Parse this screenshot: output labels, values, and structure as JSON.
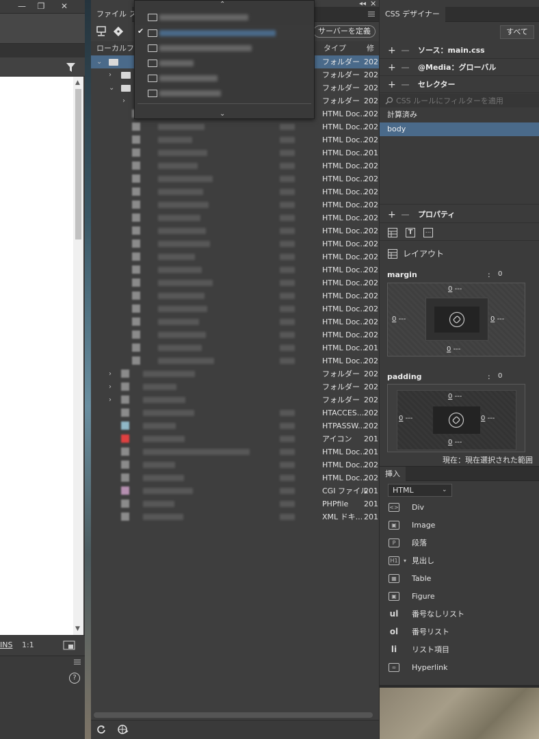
{
  "left_window": {
    "minimize": "—",
    "restore": "❐",
    "close": "✕",
    "status_ins": "INS",
    "status_zoom": "1:1",
    "help": "?"
  },
  "files_panel": {
    "tabs": {
      "file": "ファイル",
      "second": "ス"
    },
    "define_server": "サーバーを定義",
    "header_local": "ローカルファ",
    "header_type": "タイプ",
    "header_mod": "修",
    "rows": [
      {
        "type": "フォルダー",
        "mod": "202"
      },
      {
        "type": "フォルダー",
        "mod": "202"
      },
      {
        "type": "フォルダー",
        "mod": "202"
      },
      {
        "type": "フォルダー",
        "mod": "202"
      },
      {
        "type": "HTML Doc...",
        "mod": "202"
      },
      {
        "type": "HTML Doc...",
        "mod": "202"
      },
      {
        "type": "HTML Doc...",
        "mod": "202"
      },
      {
        "type": "HTML Doc...",
        "mod": "201"
      },
      {
        "type": "HTML Doc...",
        "mod": "202"
      },
      {
        "type": "HTML Doc...",
        "mod": "202"
      },
      {
        "type": "HTML Doc...",
        "mod": "202"
      },
      {
        "type": "HTML Doc...",
        "mod": "202"
      },
      {
        "type": "HTML Doc...",
        "mod": "202"
      },
      {
        "type": "HTML Doc...",
        "mod": "202"
      },
      {
        "type": "HTML Doc...",
        "mod": "202"
      },
      {
        "type": "HTML Doc...",
        "mod": "202"
      },
      {
        "type": "HTML Doc...",
        "mod": "202"
      },
      {
        "type": "HTML Doc...",
        "mod": "202"
      },
      {
        "type": "HTML Doc...",
        "mod": "202"
      },
      {
        "type": "HTML Doc...",
        "mod": "202"
      },
      {
        "type": "HTML Doc...",
        "mod": "202"
      },
      {
        "type": "HTML Doc...",
        "mod": "202"
      },
      {
        "type": "HTML Doc...",
        "mod": "201"
      },
      {
        "type": "HTML Doc...",
        "mod": "202"
      },
      {
        "type": "フォルダー",
        "mod": "202"
      },
      {
        "type": "フォルダー",
        "mod": "202"
      },
      {
        "type": "フォルダー",
        "mod": "202"
      },
      {
        "type": "HTACCES...",
        "mod": "202"
      },
      {
        "type": "HTPASSW...",
        "mod": "202"
      },
      {
        "type": "アイコン",
        "mod": "201"
      },
      {
        "type": "HTML Doc...",
        "mod": "201"
      },
      {
        "type": "HTML Doc...",
        "mod": "202"
      },
      {
        "type": "HTML Doc...",
        "mod": "202"
      },
      {
        "type": "CGI ファイル",
        "mod": "201"
      },
      {
        "type": "PHPfile",
        "mod": "201"
      },
      {
        "type": "XML ドキ...",
        "mod": "201"
      }
    ]
  },
  "css_designer": {
    "title": "CSS デザイナー",
    "all_button": "すべて",
    "source_label": "ソース：main.css",
    "media_label": "@Media：グローバル",
    "selector_label": "セレクター",
    "filter_placeholder": "CSS ルールにフィルターを適用",
    "computed": "計算済み",
    "selected_rule": "body",
    "properties_label": "プロパティ",
    "layout_label": "レイアウト",
    "margin_label": "margin",
    "margin_colon": ":",
    "margin_value": "0",
    "padding_label": "padding",
    "padding_colon": ":",
    "padding_value": "0",
    "zero": "0",
    "dash": "---",
    "status_text": "現在：現在選択された範囲",
    "accent": "#4a6a8a"
  },
  "insert_panel": {
    "tab": "挿入",
    "category": "HTML",
    "items": [
      {
        "icon": "div-icon",
        "glyph": "<>",
        "label": "Div"
      },
      {
        "icon": "image-icon",
        "glyph": "▣",
        "label": "Image"
      },
      {
        "icon": "paragraph-icon",
        "glyph": "P",
        "label": "段落"
      },
      {
        "icon": "heading-icon",
        "glyph": "H1",
        "label": "見出し"
      },
      {
        "icon": "table-icon",
        "glyph": "▦",
        "label": "Table"
      },
      {
        "icon": "figure-icon",
        "glyph": "▣",
        "label": "Figure"
      },
      {
        "icon": "ul-icon",
        "glyph": "ul",
        "label": "番号なしリスト"
      },
      {
        "icon": "ol-icon",
        "glyph": "ol",
        "label": "番号リスト"
      },
      {
        "icon": "li-icon",
        "glyph": "li",
        "label": "リスト項目"
      },
      {
        "icon": "hyperlink-icon",
        "glyph": "∞",
        "label": "Hyperlink"
      }
    ]
  }
}
